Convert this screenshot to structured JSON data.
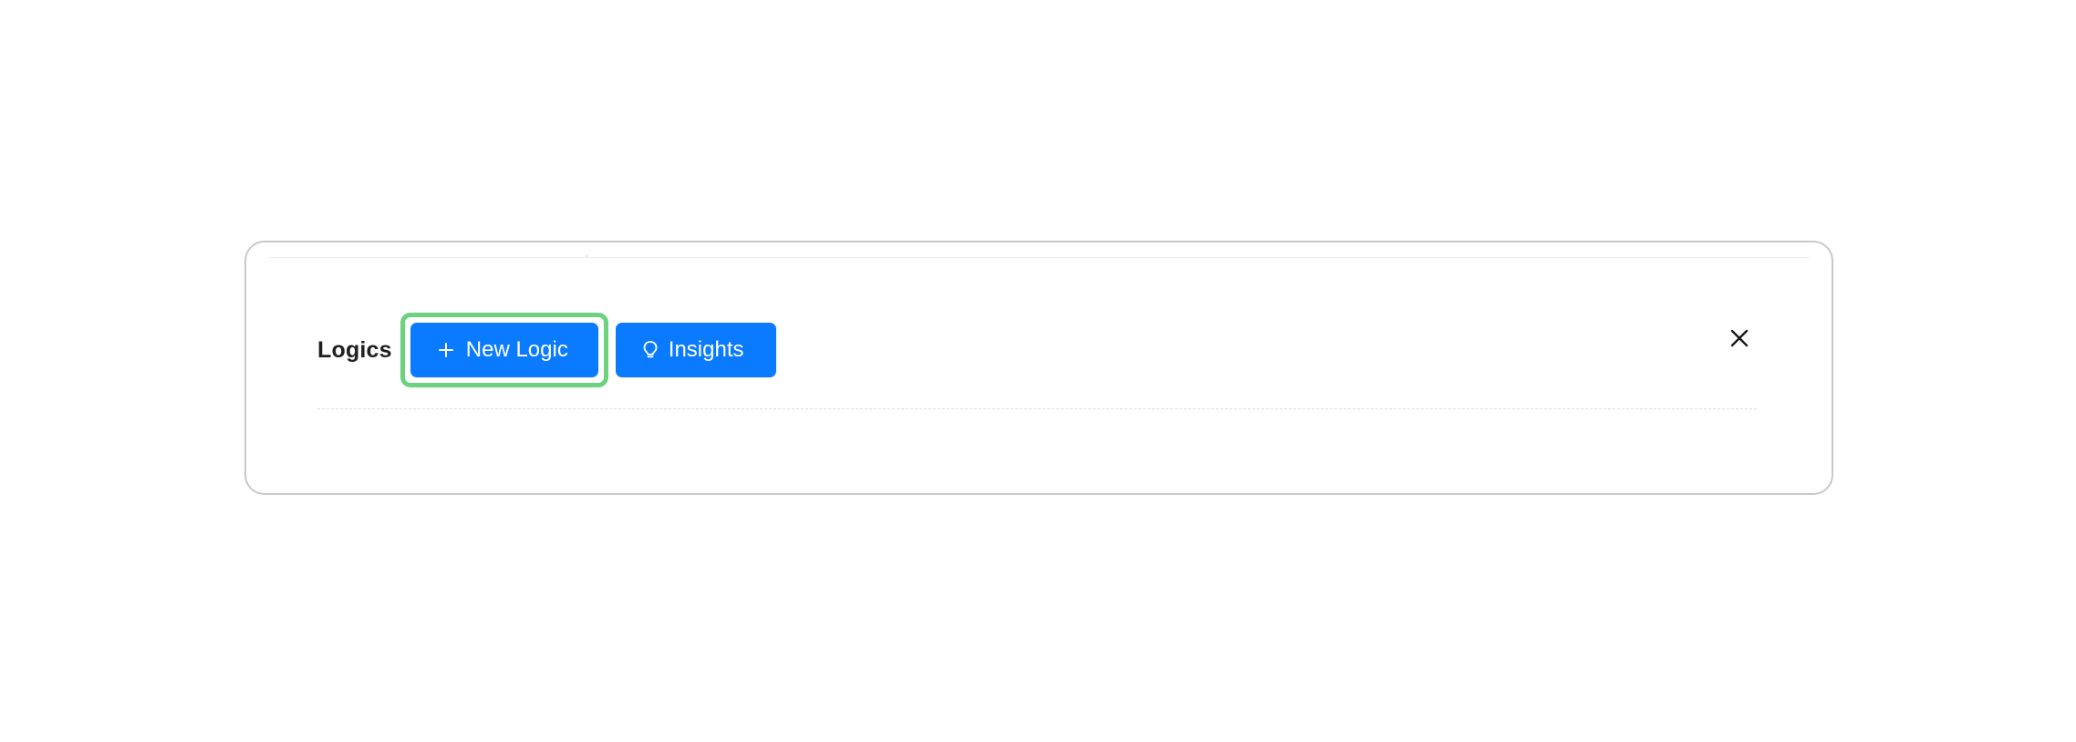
{
  "panel": {
    "title": "Logics",
    "new_logic_label": "New Logic",
    "insights_label": "Insights"
  },
  "icons": {
    "new_logic": "plus-icon",
    "insights": "lightbulb-icon",
    "close": "close-icon"
  },
  "colors": {
    "primary_button": "#0a7bff",
    "focus_ring": "#6cd27d",
    "title_text": "#1f1f1f",
    "card_border": "#c9c9c9"
  }
}
